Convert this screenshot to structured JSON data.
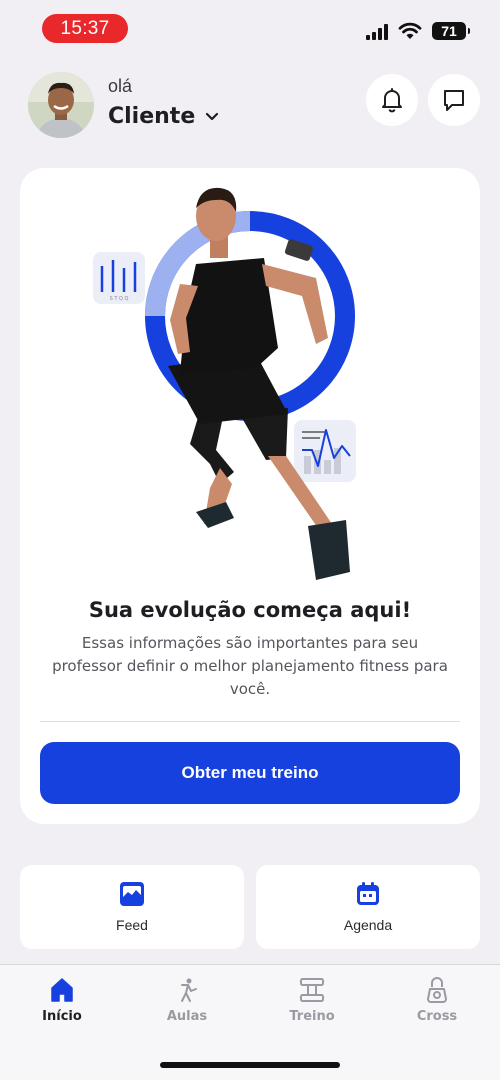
{
  "status_bar": {
    "time": "15:37",
    "battery": "71",
    "icons": [
      "signal-icon",
      "wifi-icon",
      "battery-icon"
    ],
    "time_pill_color": "#e8282b"
  },
  "header": {
    "greeting": "olá",
    "user_name": "Cliente",
    "icons": [
      "avatar",
      "chevron-down-icon",
      "bell-icon",
      "chat-icon"
    ]
  },
  "hero": {
    "title": "Sua evolução começa aqui!",
    "description": "Essas informações são importantes para seu professor definir o melhor planejamento fitness para você.",
    "button_label": "Obter meu treino",
    "mini_chart_labels": "S T Q Q",
    "accent_color": "#1641de"
  },
  "shortcuts": [
    {
      "label": "Feed",
      "icon": "image-icon"
    },
    {
      "label": "Agenda",
      "icon": "calendar-icon"
    }
  ],
  "bottom_nav": [
    {
      "label": "Início",
      "icon": "home-icon",
      "active": true
    },
    {
      "label": "Aulas",
      "icon": "exercise-person-icon",
      "active": false
    },
    {
      "label": "Treino",
      "icon": "dumbbell-icon",
      "active": false
    },
    {
      "label": "Cross",
      "icon": "kettlebell-icon",
      "active": false
    }
  ]
}
